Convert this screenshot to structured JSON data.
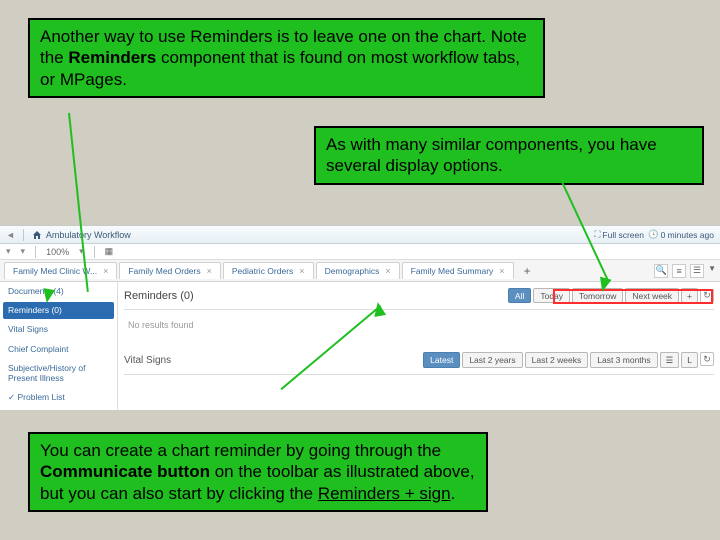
{
  "callout1": {
    "prefix": "Another way to use Reminders is to leave one on the chart.  Note the ",
    "bold": "Reminders",
    "suffix": " component that is found on most workflow tabs, or MPages."
  },
  "callout2": "As with many similar components, you have several display options.",
  "callout3": {
    "p1": "You can create a chart reminder by going through the ",
    "b1": "Communicate button",
    "p2": " on the toolbar as illustrated above, but you can also start by clicking the ",
    "b2": "Reminders + sign",
    "p3": "."
  },
  "toolbar": {
    "workflow": "Ambulatory Workflow",
    "zoom": "100%",
    "fullscreen": "Full screen",
    "ago": "0 minutes ago"
  },
  "subbar": {
    "list": "List"
  },
  "tabs": [
    "Family Med Clinic W...",
    "Family Med Orders",
    "Pediatric Orders",
    "Demographics",
    "Family Med Summary"
  ],
  "sidebar": {
    "items": [
      {
        "label": "Documents (4)",
        "sel": false,
        "check": false
      },
      {
        "label": "Reminders (0)",
        "sel": true,
        "check": false
      },
      {
        "label": "Vital Signs",
        "sel": false,
        "check": false
      },
      {
        "label": "Chief Complaint",
        "sel": false,
        "check": false
      },
      {
        "label": "Subjective/History of Present Illness",
        "sel": false,
        "check": false
      },
      {
        "label": "Problem List",
        "sel": false,
        "check": true
      }
    ]
  },
  "reminders": {
    "title": "Reminders (0)",
    "empty": "No results found",
    "filters": [
      "All",
      "Today",
      "Tomorrow",
      "Next week"
    ]
  },
  "vitals": {
    "title": "Vital Signs",
    "filters": [
      "Latest",
      "Last 2 years",
      "Last 2 weeks",
      "Last 3 months"
    ]
  }
}
